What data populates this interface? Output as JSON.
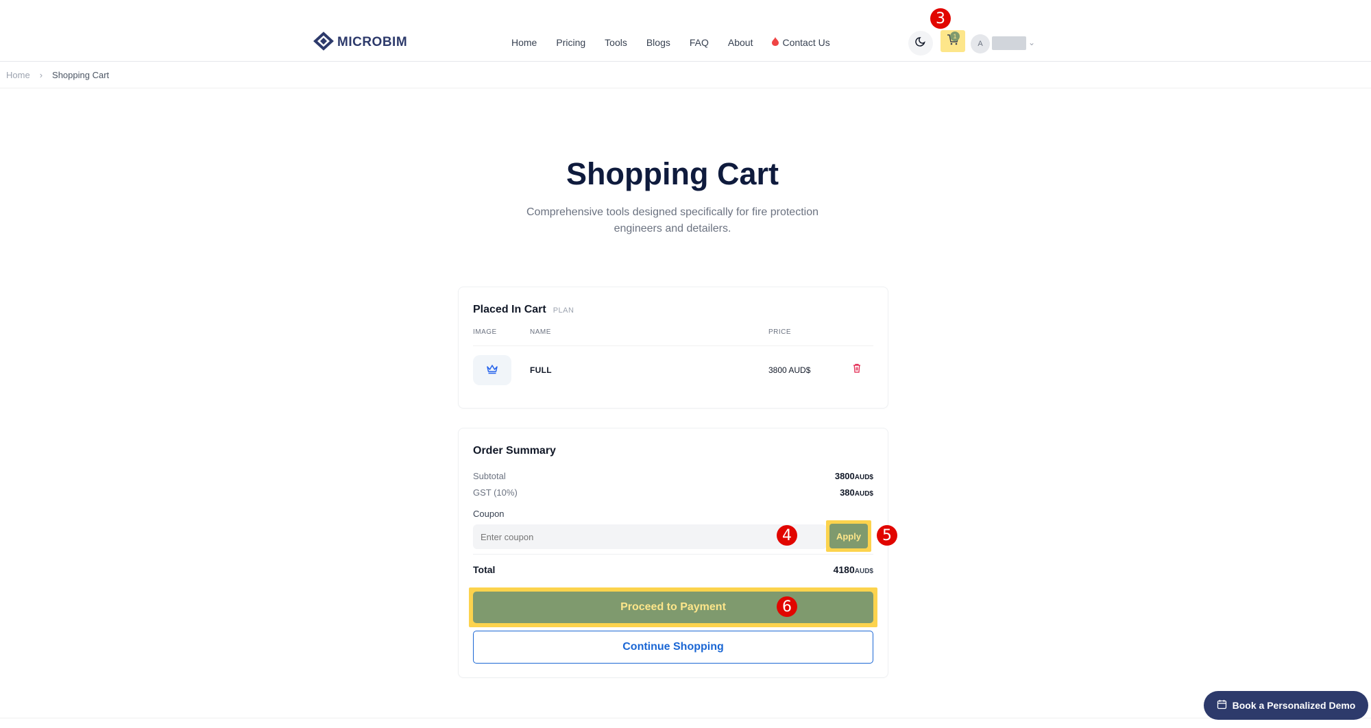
{
  "brand": {
    "name": "MICROBIM"
  },
  "nav": {
    "items": [
      {
        "label": "Home"
      },
      {
        "label": "Pricing"
      },
      {
        "label": "Tools"
      },
      {
        "label": "Blogs"
      },
      {
        "label": "FAQ"
      },
      {
        "label": "About"
      },
      {
        "label": "Contact Us"
      }
    ]
  },
  "header": {
    "cart_count": "1",
    "avatar_initial": "A"
  },
  "markers": {
    "m3": "3",
    "m4": "4",
    "m5": "5",
    "m6": "6"
  },
  "breadcrumb": {
    "home": "Home",
    "current": "Shopping Cart"
  },
  "hero": {
    "title": "Shopping Cart",
    "subtitle": "Comprehensive tools designed specifically for fire protection engineers and detailers."
  },
  "cart": {
    "heading": "Placed In Cart",
    "tag": "PLAN",
    "columns": {
      "image": "IMAGE",
      "name": "NAME",
      "price": "PRICE"
    },
    "items": [
      {
        "name": "FULL",
        "price": "3800 AUD$"
      }
    ]
  },
  "summary": {
    "heading": "Order Summary",
    "subtotal_label": "Subtotal",
    "subtotal_value": "3800",
    "gst_label": "GST (10%)",
    "gst_value": "380",
    "currency": "AUD$",
    "coupon_label": "Coupon",
    "coupon_placeholder": "Enter coupon",
    "apply_label": "Apply",
    "total_label": "Total",
    "total_value": "4180",
    "pay_label": "Proceed to Payment",
    "continue_label": "Continue Shopping"
  },
  "demo": {
    "label": "Book a Personalized Demo"
  },
  "colors": {
    "brand": "#2d3a6b",
    "accent_green": "#7f9a6e",
    "highlight": "#fcd34d",
    "link_blue": "#1a66d4",
    "danger": "#e11d48"
  }
}
